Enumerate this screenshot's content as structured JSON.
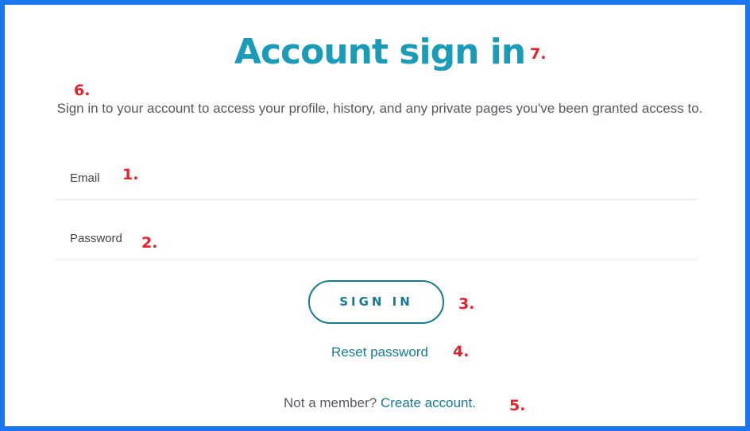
{
  "colors": {
    "border": "#1a75f0",
    "accent": "#1a9bb8",
    "link": "#177a92",
    "annotation": "#e8202a"
  },
  "header": {
    "title": "Account sign in",
    "subtitle": "Sign in to your account to access your profile, history, and any private pages you've been granted access to."
  },
  "form": {
    "email_label": "Email",
    "password_label": "Password",
    "signin_label": "SIGN IN",
    "reset_label": "Reset password",
    "member_prompt": "Not a member?",
    "create_account_label": "Create account."
  },
  "annotations": {
    "email": "1.",
    "password": "2.",
    "signin": "3.",
    "reset": "4.",
    "create": "5.",
    "subtitle": "6.",
    "title": "7."
  }
}
